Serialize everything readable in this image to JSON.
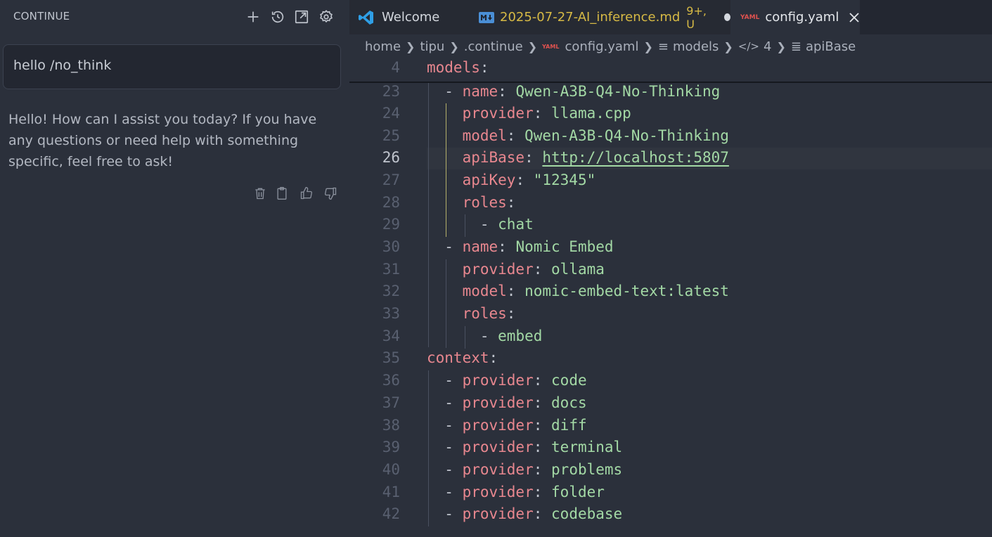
{
  "sidebar": {
    "title": "CONTINUE",
    "icons": [
      "plus-icon",
      "history-icon",
      "open-external-icon",
      "gear-icon"
    ],
    "input_text": "hello /no_think",
    "response": "Hello! How can I assist you today? If you have any questions or need help with something specific, feel free to ask!",
    "response_icons": [
      "trash-icon",
      "clipboard-icon",
      "thumbs-up-icon",
      "thumbs-down-icon"
    ]
  },
  "tabs": [
    {
      "label": "Welcome",
      "icon": "vscode-icon"
    },
    {
      "label": "2025-07-27-AI_inference.md",
      "badge": "9+, U",
      "icon": "markdown-icon",
      "color": "#d7ba45"
    },
    {
      "label": "config.yaml",
      "icon": "yaml-icon"
    }
  ],
  "breadcrumb": {
    "home": "home",
    "user": "tipu",
    "folder": ".continue",
    "file": "config.yaml",
    "section": "models",
    "index": "4",
    "key": "apiBase"
  },
  "code": {
    "lines": [
      {
        "n": "4",
        "k": "models",
        "rest": ":"
      },
      {
        "n": "23",
        "prefix": "  - ",
        "k": "name",
        "rest": ": ",
        "v": "Qwen-A3B-Q4-No-Thinking"
      },
      {
        "n": "24",
        "prefix": "    ",
        "k": "provider",
        "rest": ": ",
        "v": "llama.cpp"
      },
      {
        "n": "25",
        "prefix": "    ",
        "k": "model",
        "rest": ": ",
        "v": "Qwen-A3B-Q4-No-Thinking"
      },
      {
        "n": "26",
        "prefix": "    ",
        "k": "apiBase",
        "rest": ": ",
        "v": "http://localhost:5807"
      },
      {
        "n": "27",
        "prefix": "    ",
        "k": "apiKey",
        "rest": ": ",
        "v": "\"12345\""
      },
      {
        "n": "28",
        "prefix": "    ",
        "k": "roles",
        "rest": ":"
      },
      {
        "n": "29",
        "prefix": "      - ",
        "v": "chat"
      },
      {
        "n": "30",
        "prefix": "  - ",
        "k": "name",
        "rest": ": ",
        "v": "Nomic Embed"
      },
      {
        "n": "31",
        "prefix": "    ",
        "k": "provider",
        "rest": ": ",
        "v": "ollama"
      },
      {
        "n": "32",
        "prefix": "    ",
        "k": "model",
        "rest": ": ",
        "v": "nomic-embed-text:latest"
      },
      {
        "n": "33",
        "prefix": "    ",
        "k": "roles",
        "rest": ":"
      },
      {
        "n": "34",
        "prefix": "      - ",
        "v": "embed"
      },
      {
        "n": "35",
        "k": "context",
        "rest": ":"
      },
      {
        "n": "36",
        "prefix": "  - ",
        "k": "provider",
        "rest": ": ",
        "v": "code"
      },
      {
        "n": "37",
        "prefix": "  - ",
        "k": "provider",
        "rest": ": ",
        "v": "docs"
      },
      {
        "n": "38",
        "prefix": "  - ",
        "k": "provider",
        "rest": ": ",
        "v": "diff"
      },
      {
        "n": "39",
        "prefix": "  - ",
        "k": "provider",
        "rest": ": ",
        "v": "terminal"
      },
      {
        "n": "40",
        "prefix": "  - ",
        "k": "provider",
        "rest": ": ",
        "v": "problems"
      },
      {
        "n": "41",
        "prefix": "  - ",
        "k": "provider",
        "rest": ": ",
        "v": "folder"
      },
      {
        "n": "42",
        "prefix": "  - ",
        "k": "provider",
        "rest": ": ",
        "v": "codebase"
      }
    ],
    "active_line": "26"
  }
}
